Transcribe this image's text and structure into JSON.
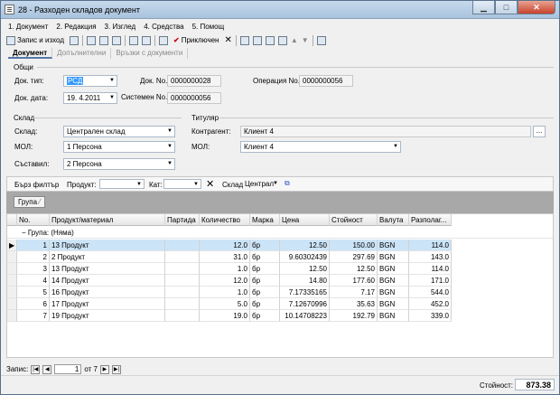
{
  "window": {
    "title": "28 - Разходен складов документ"
  },
  "menu": [
    "1. Документ",
    "2. Редакция",
    "3. Изглед",
    "4. Средства",
    "5. Помощ"
  ],
  "toolbar": {
    "save_label": "Запис и изход",
    "finish_label": "Приключен"
  },
  "tabs": [
    "Документ",
    "Допълнителни",
    "Връзки с документи"
  ],
  "general": {
    "title": "Общи",
    "doc_type_label": "Док. тип:",
    "doc_type": "РСД",
    "doc_no_label": "Док. No.",
    "doc_no": "0000000028",
    "operation_label": "Операция No.",
    "operation_no": "0000000056",
    "doc_date_label": "Док. дата:",
    "doc_date": "19.  4.2011",
    "system_label": "Системен No.",
    "system_no": "0000000056"
  },
  "warehouse": {
    "title": "Склад",
    "store_label": "Склад:",
    "store": "Централен склад",
    "mol_label": "МОЛ:",
    "mol": "1 Персона",
    "author_label": "Съставил:",
    "author": "2 Персона"
  },
  "holder": {
    "title": "Титуляр",
    "partner_label": "Контрагент:",
    "partner": "Клиент 4",
    "mol_label": "МОЛ:",
    "mol": "Клиент 4"
  },
  "filter": {
    "quick": "Бърз филтър",
    "product_label": "Продукт:",
    "cat_label": "Кат:",
    "store_label": "Склад",
    "store_value": "Централ"
  },
  "grouping": {
    "chip": "Група"
  },
  "grid": {
    "columns": [
      "No.",
      "Продукт/материал",
      "Партида",
      "Количество",
      "Марка",
      "Цена",
      "Стойност",
      "Валута",
      "Разполаг..."
    ],
    "group_row": "Група: (Няма)",
    "rows": [
      [
        "1",
        "13 Продукт",
        "",
        "12.0",
        "бр",
        "12.50",
        "150.00",
        "BGN",
        "114.0"
      ],
      [
        "2",
        "2 Продукт",
        "",
        "31.0",
        "бр",
        "9.60302439",
        "297.69",
        "BGN",
        "143.0"
      ],
      [
        "3",
        "13 Продукт",
        "",
        "1.0",
        "бр",
        "12.50",
        "12.50",
        "BGN",
        "114.0"
      ],
      [
        "4",
        "14 Продукт",
        "",
        "12.0",
        "бр",
        "14.80",
        "177.60",
        "BGN",
        "171.0"
      ],
      [
        "5",
        "16 Продукт",
        "",
        "1.0",
        "бр",
        "7.17335165",
        "7.17",
        "BGN",
        "544.0"
      ],
      [
        "6",
        "17 Продукт",
        "",
        "5.0",
        "бр",
        "7.12670996",
        "35.63",
        "BGN",
        "452.0"
      ],
      [
        "7",
        "19 Продукт",
        "",
        "19.0",
        "бр",
        "10.14708223",
        "192.79",
        "BGN",
        "339.0"
      ]
    ]
  },
  "nav": {
    "label": "Запис:",
    "current": "1",
    "of": "от 7"
  },
  "total": {
    "label": "Стойност:",
    "value": "873.38"
  }
}
